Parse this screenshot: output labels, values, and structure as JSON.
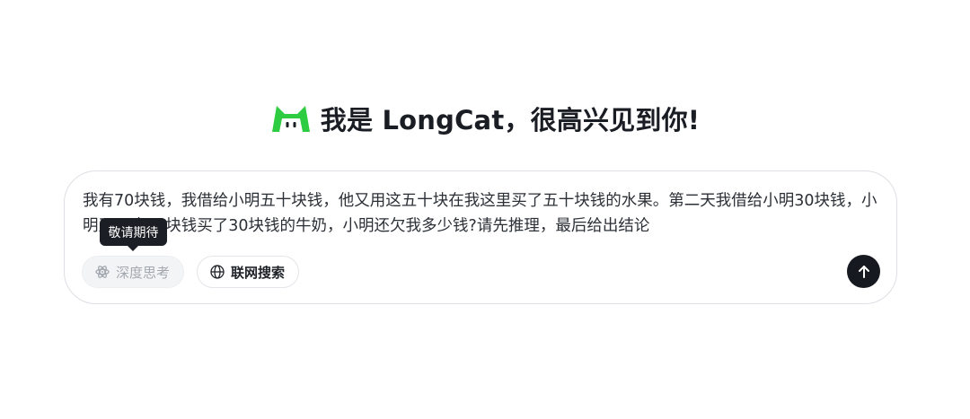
{
  "header": {
    "logo_icon": "longcat-logo-icon",
    "brand_color": "#2ecc40",
    "title": "我是 LongCat，很高兴见到你!"
  },
  "input": {
    "value": "我有70块钱，我借给小明五十块钱，他又用这五十块在我这里买了五十块钱的水果。第二天我借给小明30块钱，小明又用这30块钱买了30块钱的牛奶，小明还欠我多少钱?请先推理，最后给出结论"
  },
  "toolbar": {
    "deep_think": {
      "label": "深度思考",
      "icon": "atom-icon",
      "state": "disabled"
    },
    "web_search": {
      "label": "联网搜索",
      "icon": "globe-icon"
    },
    "send": {
      "icon": "arrow-up-icon",
      "color": "#16191f"
    }
  },
  "tooltip": {
    "text": "敬请期待"
  }
}
